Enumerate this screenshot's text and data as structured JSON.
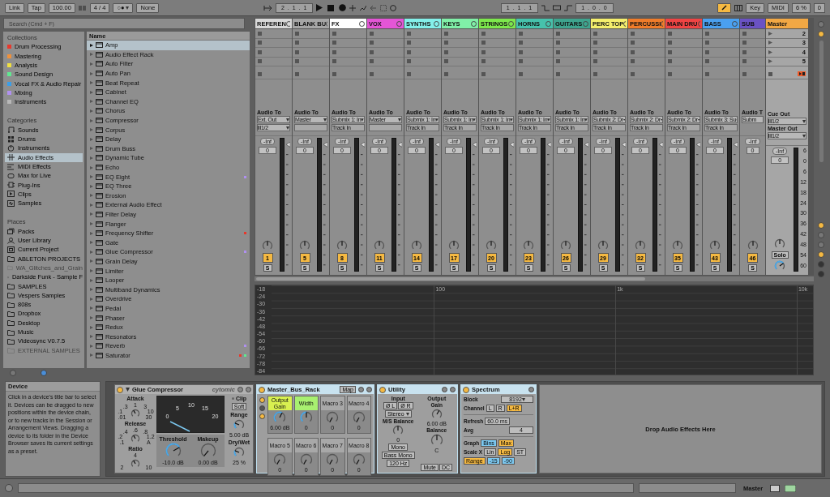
{
  "transport": {
    "link": "Link",
    "tap": "Tap",
    "tempo": "100.00",
    "signature": "4 / 4",
    "quantize_glyph": "○●",
    "quantize": "None",
    "arrangement_position": "2 . 1 . 1",
    "loop_start": "1 . 1 . 1",
    "loop_length": "1 . 0 . 0",
    "key": "Key",
    "midi": "MIDI",
    "cpu": "6 %",
    "overload": "0"
  },
  "browser": {
    "search_placeholder": "Search (Cmd + F)",
    "collections_heading": "Collections",
    "collections": [
      {
        "label": "Drum Processing",
        "color": "#e8382c"
      },
      {
        "label": "Mastering",
        "color": "#f0903a"
      },
      {
        "label": "Analysis",
        "color": "#f0e040"
      },
      {
        "label": "Sound Design",
        "color": "#60e890"
      },
      {
        "label": "Vocal FX & Audio Repair",
        "color": "#3a9ee8"
      },
      {
        "label": "Mixing",
        "color": "#b090f0"
      },
      {
        "label": "Instruments",
        "color": "#b8b8b8"
      }
    ],
    "categories_heading": "Categories",
    "categories": [
      {
        "label": "Sounds",
        "kind": "sounds",
        "selected": false
      },
      {
        "label": "Drums",
        "kind": "drums",
        "selected": false
      },
      {
        "label": "Instruments",
        "kind": "instruments",
        "selected": false
      },
      {
        "label": "Audio Effects",
        "kind": "audio_effects",
        "selected": true
      },
      {
        "label": "MIDI Effects",
        "kind": "midi_effects",
        "selected": false
      },
      {
        "label": "Max for Live",
        "kind": "max",
        "selected": false
      },
      {
        "label": "Plug-Ins",
        "kind": "plugins",
        "selected": false
      },
      {
        "label": "Clips",
        "kind": "clips",
        "selected": false
      },
      {
        "label": "Samples",
        "kind": "samples",
        "selected": false
      }
    ],
    "places_heading": "Places",
    "places": [
      {
        "label": "Packs",
        "kind": "packs",
        "disabled": false
      },
      {
        "label": "User Library",
        "kind": "user",
        "disabled": false
      },
      {
        "label": "Current Project",
        "kind": "project",
        "disabled": false
      },
      {
        "label": "ABLETON PROJECTS",
        "kind": "folder",
        "disabled": false
      },
      {
        "label": "WA_Glitches_and_Grain",
        "kind": "folder",
        "disabled": true
      },
      {
        "label": "Darkside Funk - Sample F",
        "kind": "folder",
        "disabled": false
      },
      {
        "label": "SAMPLES",
        "kind": "folder",
        "disabled": false
      },
      {
        "label": "Vespers Samples",
        "kind": "folder",
        "disabled": false
      },
      {
        "label": "808s",
        "kind": "folder",
        "disabled": false
      },
      {
        "label": "Dropbox",
        "kind": "folder",
        "disabled": false
      },
      {
        "label": "Desktop",
        "kind": "folder",
        "disabled": false
      },
      {
        "label": "Music",
        "kind": "folder",
        "disabled": false
      },
      {
        "label": "Videosync V0.7.5",
        "kind": "folder",
        "disabled": false
      },
      {
        "label": "EXTERNAL SAMPLES",
        "kind": "folder",
        "disabled": true
      }
    ],
    "column_heading": "Name",
    "items": [
      {
        "label": "Amp",
        "selected": true
      },
      {
        "label": "Audio Effect Rack",
        "selected": false
      },
      {
        "label": "Auto Filter",
        "selected": false
      },
      {
        "label": "Auto Pan",
        "selected": false
      },
      {
        "label": "Beat Repeat",
        "selected": false
      },
      {
        "label": "Cabinet",
        "selected": false
      },
      {
        "label": "Channel EQ",
        "selected": false
      },
      {
        "label": "Chorus",
        "selected": false
      },
      {
        "label": "Compressor",
        "selected": false
      },
      {
        "label": "Corpus",
        "selected": false
      },
      {
        "label": "Delay",
        "selected": false
      },
      {
        "label": "Drum Buss",
        "selected": false
      },
      {
        "label": "Dynamic Tube",
        "selected": false
      },
      {
        "label": "Echo",
        "selected": false
      },
      {
        "label": "EQ Eight",
        "selected": false,
        "tags": [
          {
            "color": "#b090f0"
          }
        ]
      },
      {
        "label": "EQ Three",
        "selected": false
      },
      {
        "label": "Erosion",
        "selected": false
      },
      {
        "label": "External Audio Effect",
        "selected": false
      },
      {
        "label": "Filter Delay",
        "selected": false
      },
      {
        "label": "Flanger",
        "selected": false
      },
      {
        "label": "Frequency Shifter",
        "selected": false,
        "tags": [
          {
            "color": "#e8382c"
          }
        ]
      },
      {
        "label": "Gate",
        "selected": false
      },
      {
        "label": "Glue Compressor",
        "selected": false,
        "tags": [
          {
            "color": "#b090f0"
          }
        ]
      },
      {
        "label": "Grain Delay",
        "selected": false
      },
      {
        "label": "Limiter",
        "selected": false
      },
      {
        "label": "Looper",
        "selected": false
      },
      {
        "label": "Multiband Dynamics",
        "selected": false
      },
      {
        "label": "Overdrive",
        "selected": false
      },
      {
        "label": "Pedal",
        "selected": false
      },
      {
        "label": "Phaser",
        "selected": false
      },
      {
        "label": "Redux",
        "selected": false
      },
      {
        "label": "Resonators",
        "selected": false
      },
      {
        "label": "Reverb",
        "selected": false,
        "tags": [
          {
            "color": "#b090f0"
          }
        ]
      },
      {
        "label": "Saturator",
        "selected": false,
        "tags": [
          {
            "color": "#e8382c"
          },
          {
            "color": "#60e890"
          }
        ]
      }
    ]
  },
  "mixer": {
    "tracks": [
      {
        "name": "REFEREN",
        "color": "#d8d8d8",
        "kind": "stereo_input",
        "audio_to_label": "Audio To",
        "output": "Ext. Out",
        "input": "1/2",
        "peak": "-Inf",
        "volume": "0",
        "number": "1",
        "solo": "S"
      },
      {
        "name": "BLANK BU",
        "color": "#a6a6a6",
        "kind": "no_input",
        "audio_to_label": "Audio To",
        "output": "Master",
        "peak": "-Inf",
        "volume": "0",
        "number": "5",
        "solo": "S"
      },
      {
        "name": "FX",
        "color": "#ffffff",
        "kind": "track_input",
        "audio_to_label": "Audio To",
        "output": "Submix 1: In",
        "input": "Track In",
        "peak": "-Inf",
        "volume": "0",
        "number": "8",
        "solo": "S"
      },
      {
        "name": "VOX",
        "color": "#e455d6",
        "kind": "no_input",
        "audio_to_label": "Audio To",
        "output": "Master",
        "peak": "-Inf",
        "volume": "0",
        "number": "11",
        "solo": "S"
      },
      {
        "name": "SYNTHS",
        "color": "#84f0ea",
        "kind": "track_input",
        "audio_to_label": "Audio To",
        "output": "Submix 1: In",
        "input": "Track In",
        "peak": "-Inf",
        "volume": "0",
        "number": "14",
        "solo": "S"
      },
      {
        "name": "KEYS",
        "color": "#80f0a8",
        "kind": "track_input",
        "audio_to_label": "Audio To",
        "output": "Submix 1: In",
        "input": "Track In",
        "peak": "-Inf",
        "volume": "0",
        "number": "17",
        "solo": "S"
      },
      {
        "name": "STRINGS",
        "color": "#7de84c",
        "kind": "track_input",
        "audio_to_label": "Audio To",
        "output": "Submix 1: In",
        "input": "Track In",
        "peak": "-Inf",
        "volume": "0",
        "number": "20",
        "solo": "S"
      },
      {
        "name": "HORNS",
        "color": "#46c2ac",
        "kind": "track_input",
        "audio_to_label": "Audio To",
        "output": "Submix 1: In",
        "input": "Track In",
        "peak": "-Inf",
        "volume": "0",
        "number": "23",
        "solo": "S"
      },
      {
        "name": "GUITARS",
        "color": "#3ea48e",
        "kind": "track_input",
        "audio_to_label": "Audio To",
        "output": "Submix 1: In",
        "input": "Track In",
        "peak": "-Inf",
        "volume": "0",
        "number": "26",
        "solo": "S"
      },
      {
        "name": "PERC TOP",
        "color": "#f5ef6c",
        "kind": "track_input",
        "audio_to_label": "Audio To",
        "output": "Submix 2: Dr",
        "input": "Track In",
        "peak": "-Inf",
        "volume": "0",
        "number": "29",
        "solo": "S"
      },
      {
        "name": "PERCUSSI",
        "color": "#f07c2a",
        "kind": "track_input",
        "audio_to_label": "Audio To",
        "output": "Submix 2: Dr",
        "input": "Track In",
        "peak": "-Inf",
        "volume": "0",
        "number": "32",
        "solo": "S"
      },
      {
        "name": "MAIN DRU",
        "color": "#f04444",
        "kind": "track_input",
        "audio_to_label": "Audio To",
        "output": "Submix 2: Dr",
        "input": "Track In",
        "peak": "-Inf",
        "volume": "0",
        "number": "35",
        "solo": "S"
      },
      {
        "name": "BASS",
        "color": "#4aa0f0",
        "kind": "track_input",
        "audio_to_label": "Audio To",
        "output": "Submix 3: Su",
        "input": "Track In",
        "peak": "-Inf",
        "volume": "0",
        "number": "43",
        "solo": "S"
      },
      {
        "name": "SUB",
        "color": "#6a52c4",
        "kind": "clipped",
        "audio_to_label": "Audio T",
        "output": "Subm",
        "peak": "-Inf",
        "volume": "0",
        "number": "46",
        "solo": "S"
      }
    ],
    "master": {
      "name": "Master",
      "color": "#f2a844",
      "scenes": [
        "2",
        "3",
        "4",
        "5"
      ],
      "cue_out_label": "Cue Out",
      "cue_out": "1/2",
      "master_out_label": "Master Out",
      "master_out": "1/2",
      "peak": "-Inf",
      "volume": "0",
      "solo": "Solo",
      "scale": [
        "6",
        "0",
        "6",
        "12",
        "18",
        "24",
        "30",
        "36",
        "42",
        "48",
        "54",
        "60"
      ]
    }
  },
  "spectrum_view": {
    "y_labels": [
      "-18",
      "-24",
      "-30",
      "-36",
      "-42",
      "-48",
      "-54",
      "-60",
      "-66",
      "-72",
      "-78",
      "-84"
    ],
    "x_labels": [
      "100",
      "1k",
      "10k"
    ]
  },
  "info": {
    "title": "Device",
    "text": "Click in a device's title bar to select it. Devices can be dragged to new positions within the device chain, or to new tracks in the Session or Arrangement Views. Dragging a device to its folder in the Device Browser saves its current settings as a preset."
  },
  "glue": {
    "title": "Glue Compressor",
    "brand": "cytomic",
    "on": true,
    "attack": {
      "label": "Attack",
      "ticks": [
        "1",
        ".3",
        "3",
        ".1",
        "10",
        ".01",
        "30"
      ]
    },
    "release": {
      "label": "Release",
      "ticks": [
        ".6",
        ".4",
        ".8",
        ".2",
        "1.2",
        ".1",
        "A"
      ]
    },
    "ratio": {
      "label": "Ratio",
      "ticks": [
        "4",
        "2",
        "10"
      ]
    },
    "meter_ticks": [
      "0",
      "5",
      "10",
      "15",
      "20"
    ],
    "threshold": {
      "label": "Threshold",
      "value": "-10.0 dB",
      "level": 0.72
    },
    "makeup": {
      "label": "Makeup",
      "value": "0.00 dB"
    },
    "clip": "Clip",
    "clip_mode": "Soft",
    "range": {
      "label": "Range",
      "value": "5.00 dB",
      "level": 0.25
    },
    "dry_wet": {
      "label": "Dry/Wet",
      "value": "25 %",
      "level": 0.25
    }
  },
  "rack": {
    "title": "Master_Bus_Rack",
    "map": "Map",
    "on": true,
    "macros": [
      {
        "label": "Output Gain",
        "value": "6.00 dB",
        "color": "#d8f050",
        "level": 0.6
      },
      {
        "label": "Width",
        "value": "0",
        "color": "#a8f070",
        "level": 0.5
      },
      {
        "label": "Macro 3",
        "value": "0"
      },
      {
        "label": "Macro 4",
        "value": "0"
      },
      {
        "label": "Macro 5",
        "value": "0"
      },
      {
        "label": "Macro 6",
        "value": "0"
      },
      {
        "label": "Macro 7",
        "value": "0"
      },
      {
        "label": "Macro 8",
        "value": "0"
      }
    ]
  },
  "utility": {
    "title": "Utility",
    "on": true,
    "input_label": "Input",
    "phase_l": "Ø L",
    "phase_r": "Ø R",
    "channel_mode": "Stereo",
    "ms_label": "M/S Balance",
    "ms_value": "0",
    "mono": "Mono",
    "bass_mono": "Bass Mono",
    "bass_freq": "120 Hz",
    "output_label": "Output",
    "gain_label": "Gain",
    "gain_value": "6.00 dB",
    "balance_label": "Balance",
    "balance_value": "C",
    "mute": "Mute",
    "dc": "DC"
  },
  "spectrum": {
    "title": "Spectrum",
    "on": true,
    "block_label": "Block",
    "block": "8192",
    "channel_label": "Channel",
    "channels": [
      {
        "label": "L",
        "selected": false
      },
      {
        "label": "R",
        "selected": false
      },
      {
        "label": "L+R",
        "selected": true
      }
    ],
    "refresh_label": "Refresh",
    "refresh": "60.0 ms",
    "avg_label": "Avg",
    "avg": "4",
    "graph_label": "Graph",
    "graph": [
      {
        "label": "Bins",
        "selected": true,
        "color": "#7cc8f0"
      },
      {
        "label": "Max",
        "selected": true,
        "color": "#f5b942"
      }
    ],
    "scale_label": "Scale X",
    "scale": [
      {
        "label": "Lin",
        "selected": false
      },
      {
        "label": "Log",
        "selected": true
      },
      {
        "label": "ST",
        "selected": false
      }
    ],
    "range": "Range",
    "range_min": "-15",
    "range_max": "-90"
  },
  "drop_hint": "Drop Audio Effects Here",
  "status": {
    "track": "Master"
  }
}
